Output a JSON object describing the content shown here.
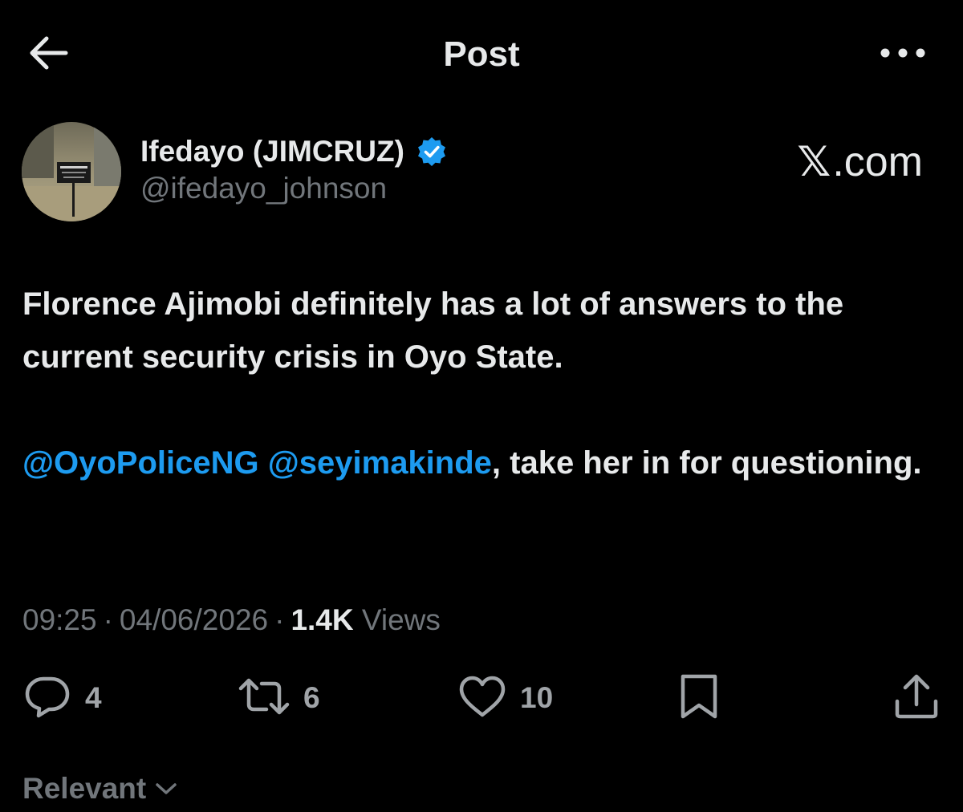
{
  "header": {
    "title": "Post",
    "back_icon": "arrow-left-icon",
    "more_icon": "more-horizontal-icon"
  },
  "author": {
    "display_name": "Ifedayo (JIMCRUZ)",
    "handle": "@ifedayo_johnson",
    "verified": true,
    "verified_color": "#1d9bf0"
  },
  "watermark": {
    "x_glyph": "𝕏",
    "text": ".com"
  },
  "post": {
    "paragraph1": "Florence Ajimobi definitely has a lot of answers to the current security crisis in Oyo State.",
    "mention1": "@OyoPoliceNG",
    "mention2": "@seyimakinde",
    "paragraph2_rest": ", take her in for questioning."
  },
  "meta": {
    "time": "09:25",
    "date": "04/06/2026",
    "views_count": "1.4K",
    "views_label": "Views",
    "separator": "·"
  },
  "actions": {
    "replies": "4",
    "reposts": "6",
    "likes": "10"
  },
  "sort": {
    "label": "Relevant"
  },
  "colors": {
    "background": "#000000",
    "text_primary": "#e7e9ea",
    "text_secondary": "#71767b",
    "accent": "#1d9bf0"
  }
}
